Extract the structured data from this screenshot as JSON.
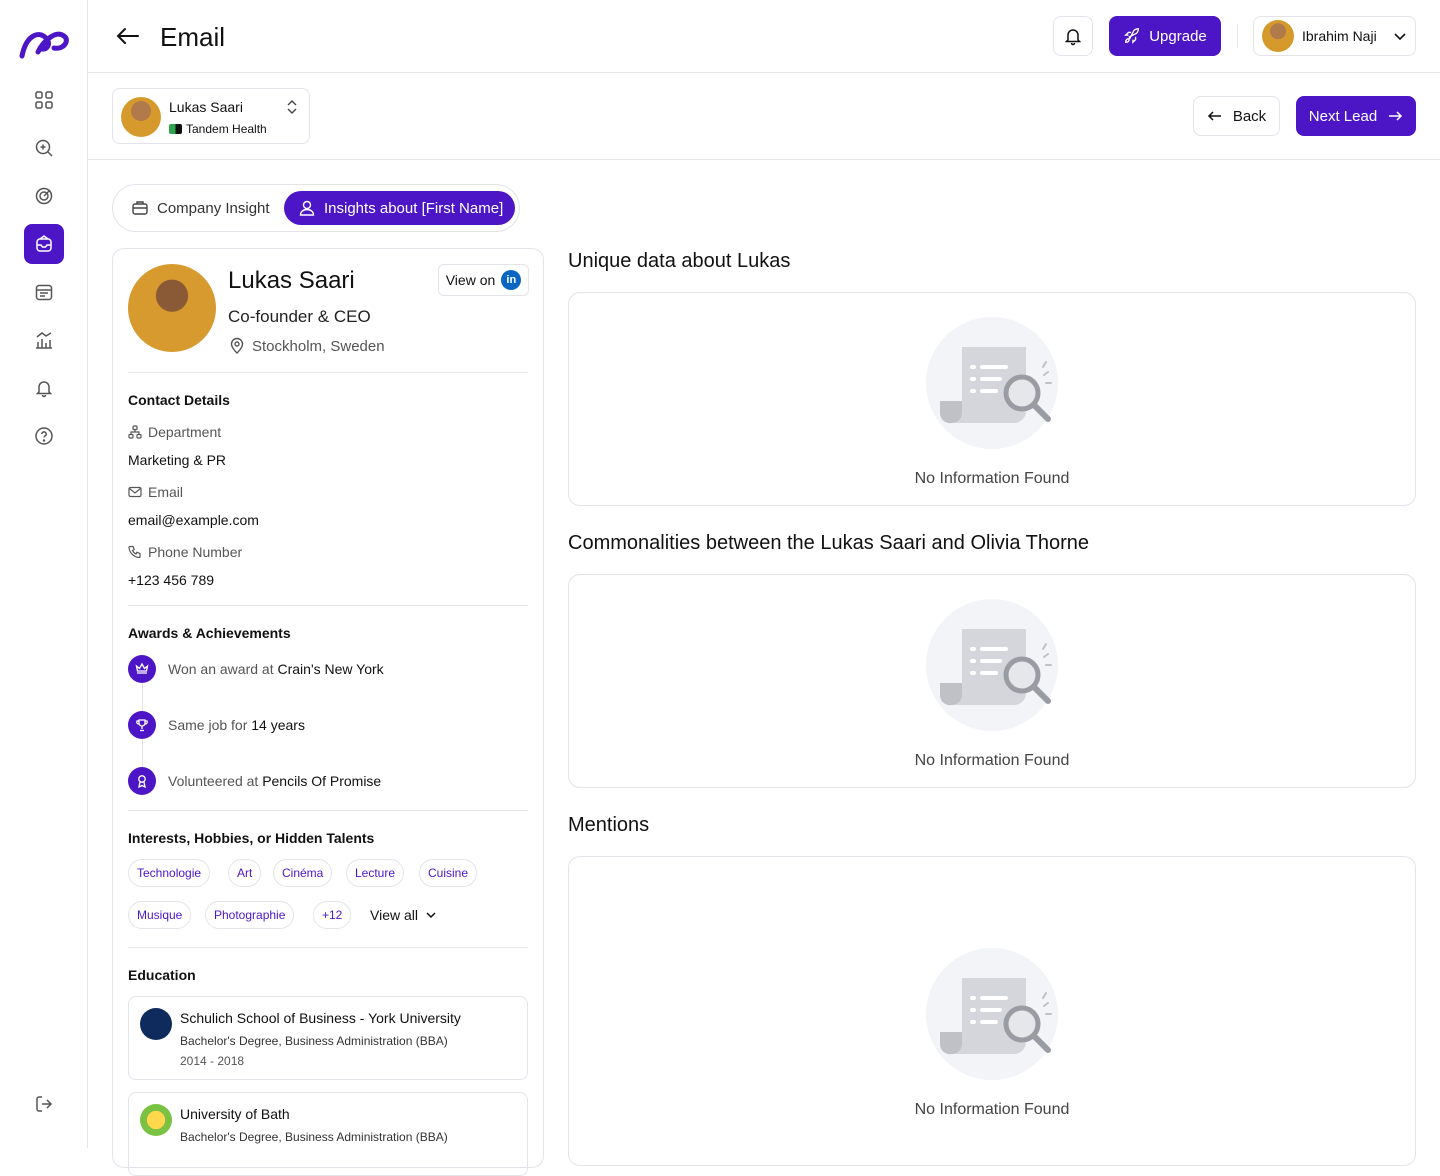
{
  "header": {
    "title": "Email",
    "upgrade_label": "Upgrade",
    "user_name": "Ibrahim Naji"
  },
  "sidebar": {
    "items": [
      {
        "icon": "grid-icon"
      },
      {
        "icon": "search-icon"
      },
      {
        "icon": "target-icon"
      },
      {
        "icon": "inbox-icon",
        "active": true
      },
      {
        "icon": "calendar-icon"
      },
      {
        "icon": "chart-icon"
      },
      {
        "icon": "bell-icon"
      },
      {
        "icon": "help-icon"
      }
    ]
  },
  "lead": {
    "name": "Lukas Saari",
    "company": "Tandem Health"
  },
  "nav": {
    "back_label": "Back",
    "next_label": "Next Lead"
  },
  "tabs": [
    {
      "label": "Company Insight"
    },
    {
      "label": "Insights about [First Name]",
      "active": true
    }
  ],
  "profile": {
    "name": "Lukas Saari",
    "role": "Co-founder & CEO",
    "location": "Stockholm, Sweden",
    "view_on_label": "View on",
    "linkedin": "in",
    "contact_title": "Contact Details",
    "department_label": "Department",
    "department": "Marketing & PR",
    "email_label": "Email",
    "email": "email@example.com",
    "phone_label": "Phone Number",
    "phone": "+123 456 789",
    "awards_title": "Awards & Achievements",
    "awards": [
      {
        "prefix": "Won an award at",
        "highlight": "Crain's New York"
      },
      {
        "prefix": "Same job for",
        "highlight": "14 years"
      },
      {
        "prefix": "Volunteered at",
        "highlight": "Pencils Of Promise"
      }
    ],
    "interests_title": "Interests, Hobbies, or Hidden Talents",
    "interests": [
      "Technologie",
      "Art",
      "Cinéma",
      "Lecture",
      "Cuisine",
      "Musique",
      "Photographie",
      "+12"
    ],
    "view_all_label": "View all",
    "education_title": "Education",
    "education": [
      {
        "school": "Schulich School of Business - York University",
        "degree": "Bachelor's Degree, Business Administration (BBA)",
        "years": "2014 - 2018"
      },
      {
        "school": "University of Bath",
        "degree": "Bachelor's Degree, Business Administration (BBA)",
        "years": ""
      }
    ]
  },
  "sections": {
    "unique_title": "Unique data about Lukas",
    "common_title": "Commonalities between the Lukas Saari and Olivia Thorne",
    "mentions_title": "Mentions",
    "empty_text": "No Information Found"
  },
  "colors": {
    "accent": "#4c16c7",
    "border": "#e2e4e9"
  }
}
